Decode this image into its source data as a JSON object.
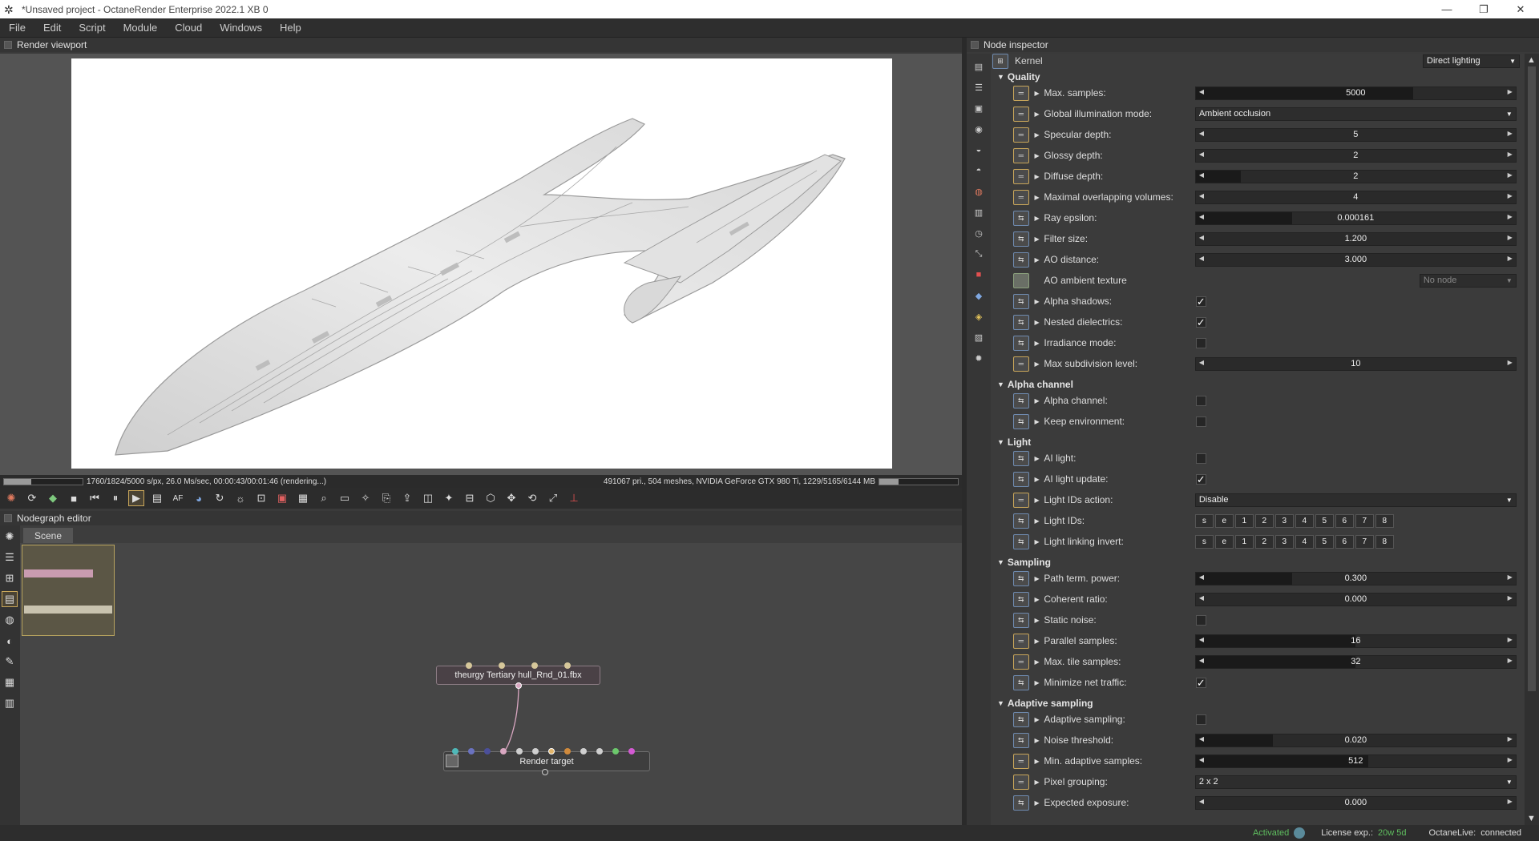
{
  "window": {
    "title": "*Unsaved project - OctaneRender Enterprise 2022.1 XB 0",
    "controls": [
      "—",
      "❐",
      "✕"
    ]
  },
  "menu": [
    "File",
    "Edit",
    "Script",
    "Module",
    "Cloud",
    "Windows",
    "Help"
  ],
  "render_viewport": {
    "panel_title": "Render viewport",
    "render_subject": "starship",
    "progress": 0.35,
    "status_left": "1760/1824/5000 s/px, 26.0 Ms/sec, 00:00:43/00:01:46 (rendering...)",
    "status_right": "491067 pri., 504 meshes, NVIDIA GeForce GTX 980 Ti, 1229/5165/6144 MB",
    "gpu_mem_fraction": 0.24
  },
  "toolbar": {
    "icons": [
      "octane-logo-icon",
      "refresh-icon",
      "cube-icon",
      "stop-icon",
      "rewind-icon",
      "pause-icon",
      "play-icon",
      "settings-icon",
      "af-icon",
      "color-icon",
      "sync-icon",
      "light-icon",
      "region-icon",
      "film-region-icon",
      "clay-icon",
      "zoom-icon",
      "viewport-icon",
      "pick-icon",
      "copy-icon",
      "export-icon",
      "layers-icon",
      "denoise-icon",
      "lock-icon",
      "box-icon",
      "move-icon",
      "rotate-icon",
      "fullscreen-icon",
      "gizmo-icon"
    ],
    "af_label": "AF"
  },
  "nodegraph": {
    "panel_title": "Nodegraph editor",
    "tab": "Scene",
    "nodes": [
      {
        "label": "theurgy Tertiary hull_Rnd_01.fbx"
      },
      {
        "label": "Render target"
      }
    ]
  },
  "inspector": {
    "panel_title": "Node inspector",
    "kernel_label": "Kernel",
    "kernel_value": "Direct lighting",
    "sections": [
      {
        "title": "Quality",
        "rows": [
          {
            "label": "Max. samples:",
            "type": "slider",
            "value": "5000",
            "fill": 0.68,
            "btn": "y"
          },
          {
            "label": "Global illumination mode:",
            "type": "dropdown",
            "value": "Ambient occlusion",
            "btn": "y"
          },
          {
            "label": "Specular depth:",
            "type": "slider",
            "value": "5",
            "fill": 0.0,
            "btn": "y"
          },
          {
            "label": "Glossy depth:",
            "type": "slider",
            "value": "2",
            "fill": 0.0,
            "btn": "y"
          },
          {
            "label": "Diffuse depth:",
            "type": "slider",
            "value": "2",
            "fill": 0.14,
            "btn": "y"
          },
          {
            "label": "Maximal overlapping volumes:",
            "type": "slider",
            "value": "4",
            "fill": 0.0,
            "btn": "y"
          },
          {
            "label": "Ray epsilon:",
            "type": "slider",
            "value": "0.000161",
            "fill": 0.3,
            "btn": "b"
          },
          {
            "label": "Filter size:",
            "type": "slider",
            "value": "1.200",
            "fill": 0.0,
            "btn": "b"
          },
          {
            "label": "AO distance:",
            "type": "slider",
            "value": "3.000",
            "fill": 0.0,
            "btn": "b"
          },
          {
            "label": "AO ambient texture",
            "type": "node",
            "value": "No node",
            "btn": "g"
          },
          {
            "label": "Alpha shadows:",
            "type": "check",
            "checked": true,
            "btn": "b"
          },
          {
            "label": "Nested dielectrics:",
            "type": "check",
            "checked": true,
            "btn": "b"
          },
          {
            "label": "Irradiance mode:",
            "type": "check",
            "checked": false,
            "btn": "b"
          },
          {
            "label": "Max subdivision level:",
            "type": "slider",
            "value": "10",
            "fill": 0.0,
            "btn": "y"
          }
        ]
      },
      {
        "title": "Alpha channel",
        "rows": [
          {
            "label": "Alpha channel:",
            "type": "check",
            "checked": false,
            "btn": "b"
          },
          {
            "label": "Keep environment:",
            "type": "check",
            "checked": false,
            "btn": "b"
          }
        ]
      },
      {
        "title": "Light",
        "rows": [
          {
            "label": "AI light:",
            "type": "check",
            "checked": false,
            "btn": "b"
          },
          {
            "label": "AI light update:",
            "type": "check",
            "checked": true,
            "btn": "b"
          },
          {
            "label": "Light IDs action:",
            "type": "dropdown",
            "value": "Disable",
            "btn": "y"
          },
          {
            "label": "Light IDs:",
            "type": "ids",
            "btn": "b"
          },
          {
            "label": "Light linking invert:",
            "type": "ids",
            "btn": "b"
          }
        ]
      },
      {
        "title": "Sampling",
        "rows": [
          {
            "label": "Path term. power:",
            "type": "slider",
            "value": "0.300",
            "fill": 0.3,
            "btn": "b"
          },
          {
            "label": "Coherent ratio:",
            "type": "slider",
            "value": "0.000",
            "fill": 0.0,
            "btn": "b"
          },
          {
            "label": "Static noise:",
            "type": "check",
            "checked": false,
            "btn": "b"
          },
          {
            "label": "Parallel samples:",
            "type": "slider",
            "value": "16",
            "fill": 0.5,
            "btn": "y"
          },
          {
            "label": "Max. tile samples:",
            "type": "slider",
            "value": "32",
            "fill": 0.5,
            "btn": "y"
          },
          {
            "label": "Minimize net traffic:",
            "type": "check",
            "checked": true,
            "btn": "b"
          }
        ]
      },
      {
        "title": "Adaptive sampling",
        "rows": [
          {
            "label": "Adaptive sampling:",
            "type": "check",
            "checked": false,
            "btn": "b"
          },
          {
            "label": "Noise threshold:",
            "type": "slider",
            "value": "0.020",
            "fill": 0.24,
            "btn": "b"
          },
          {
            "label": "Min. adaptive samples:",
            "type": "slider",
            "value": "512",
            "fill": 0.54,
            "btn": "y"
          },
          {
            "label": "Pixel grouping:",
            "type": "dropdown",
            "value": "2 x 2",
            "btn": "y"
          },
          {
            "label": "Expected exposure:",
            "type": "slider",
            "value": "0.000",
            "fill": 0.0,
            "btn": "b"
          }
        ]
      }
    ],
    "id_buttons": [
      "s",
      "e",
      "1",
      "2",
      "3",
      "4",
      "5",
      "6",
      "7",
      "8"
    ]
  },
  "status": {
    "activated": "Activated",
    "license_label": "License exp.:",
    "license_value": "20w 5d",
    "live_label": "OctaneLive:",
    "live_value": "connected",
    "accent": "#5fbf5f"
  }
}
